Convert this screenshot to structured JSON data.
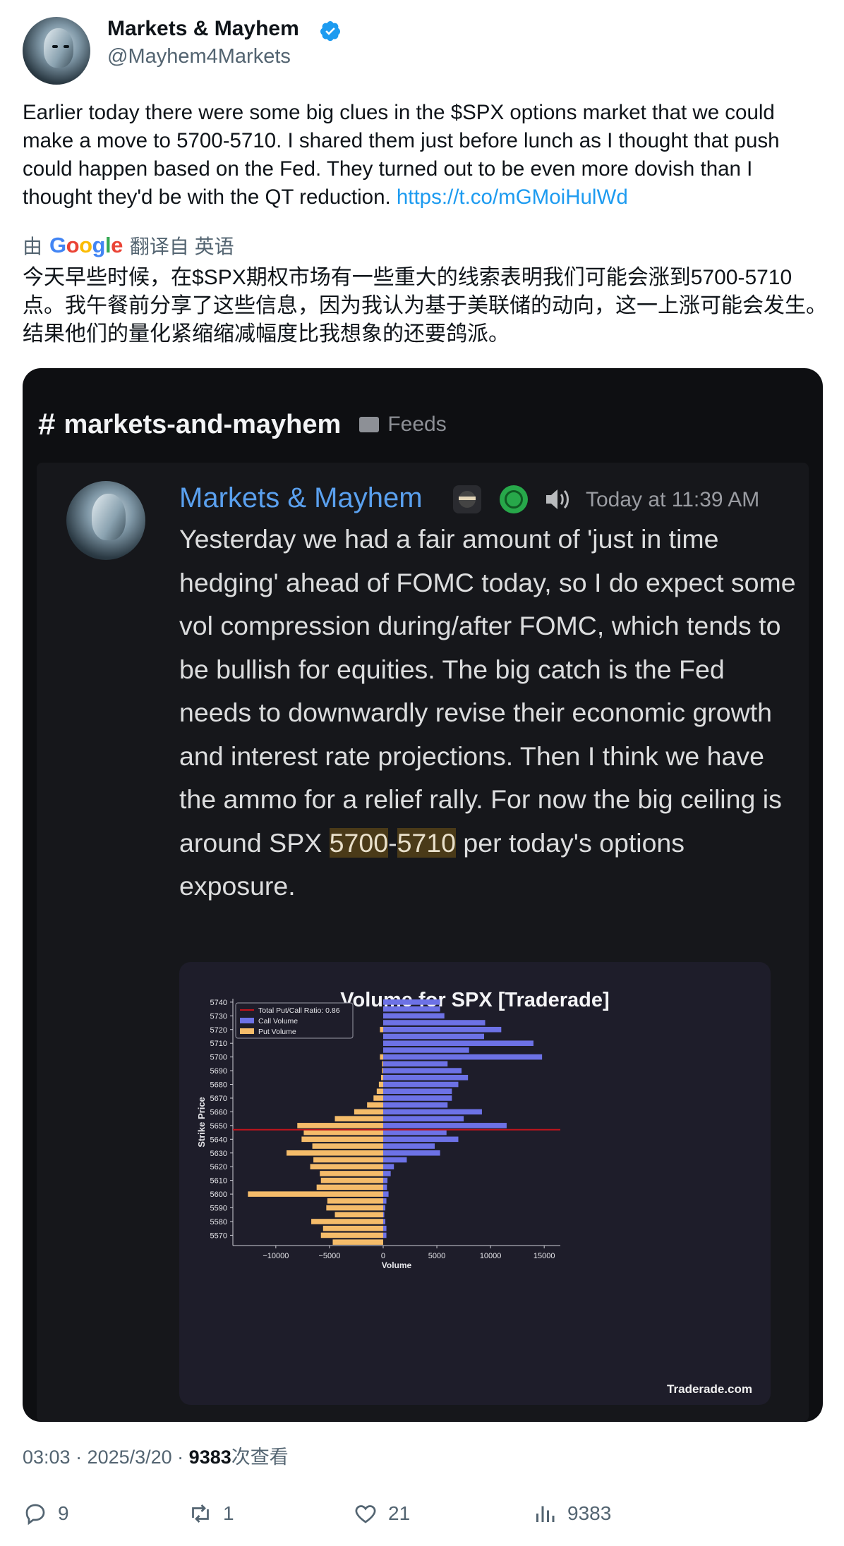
{
  "tweet": {
    "author_name": "Markets & Mayhem",
    "handle": "@Mayhem4Markets",
    "text": "Earlier today there were some big clues in the $SPX options market that we could make a move to 5700-5710. I shared them just before lunch as I thought that push could happen based on the Fed. They turned out to be even more dovish than I thought they'd be with the QT reduction.",
    "link": "https://t.co/mGMoiHulWd",
    "translate_by": "由",
    "translate_brand": "Google",
    "translate_from": "翻译自 英语",
    "translated_text": "今天早些时候，在$SPX期权市场有一些重大的线索表明我们可能会涨到5700-5710点。我午餐前分享了这些信息，因为我认为基于美联储的动向，这一上涨可能会发生。结果他们的量化紧缩缩减幅度比我想象的还要鸽派。",
    "time": "03:03 · 2025/3/20 · ",
    "views": "9383",
    "views_suffix": "次查看"
  },
  "media": {
    "channel": "markets-and-mayhem",
    "folder": "Feeds",
    "message": {
      "author": "Markets & Mayhem",
      "timestamp": "Today at 11:39 AM",
      "text_before": "Yesterday we had a fair amount of 'just in time hedging' ahead of FOMC today, so I do expect some vol compression during/after FOMC, which tends to be bullish for equities. The big catch is the Fed needs to downwardly revise their economic growth and interest rate projections. Then I think we have the ammo for a relief rally. For now the big ceiling is around SPX ",
      "hl1": "5700",
      "dash": "-",
      "hl2": "5710",
      "text_after": " per today's options exposure."
    },
    "watermark": "Traderade.com"
  },
  "chart_data": {
    "type": "bar",
    "orientation": "horizontal",
    "title": "Volume for SPX [Traderade]",
    "xlabel": "Volume",
    "ylabel": "Strike Price",
    "xlim": [
      -14000,
      16500
    ],
    "xticks": [
      -10000,
      -5000,
      0,
      5000,
      10000,
      15000
    ],
    "ytick_labels": [
      "5570",
      "5580",
      "5590",
      "5600",
      "5610",
      "5620",
      "5630",
      "5640",
      "5650",
      "5660",
      "5670",
      "5680",
      "5690",
      "5700",
      "5710",
      "5720",
      "5730",
      "5740"
    ],
    "strikes": [
      5565,
      5570,
      5575,
      5580,
      5585,
      5590,
      5595,
      5600,
      5605,
      5610,
      5615,
      5620,
      5625,
      5630,
      5635,
      5640,
      5645,
      5650,
      5655,
      5660,
      5665,
      5670,
      5675,
      5680,
      5685,
      5690,
      5695,
      5700,
      5705,
      5710,
      5715,
      5720,
      5725,
      5730,
      5735,
      5740
    ],
    "legend": [
      "Total Put/Call Ratio: 0.86",
      "Call Volume",
      "Put Volume"
    ],
    "legend_position": "top-left",
    "ratio_line_strike": 5647,
    "colors": {
      "call": "#6d72e6",
      "put": "#f5bc6a",
      "ratio": "#c0141c"
    },
    "series": [
      {
        "name": "Call Volume",
        "values": [
          0,
          300,
          300,
          200,
          100,
          200,
          300,
          500,
          350,
          400,
          700,
          1000,
          2200,
          5300,
          4800,
          7000,
          5900,
          11500,
          7500,
          9200,
          6000,
          6400,
          6400,
          7000,
          7900,
          7300,
          6000,
          14800,
          8000,
          14000,
          9400,
          11000,
          9500,
          5700,
          5300,
          5300
        ]
      },
      {
        "name": "Put Volume",
        "values": [
          -4700,
          -5800,
          -5600,
          -6700,
          -4500,
          -5300,
          -5200,
          -12600,
          -6200,
          -5800,
          -5900,
          -6800,
          -6500,
          -9000,
          -6600,
          -7600,
          -7400,
          -8000,
          -4500,
          -2700,
          -1500,
          -900,
          -600,
          -400,
          -200,
          -100,
          -100,
          -300,
          0,
          0,
          0,
          -300,
          0,
          0,
          0,
          0
        ]
      }
    ]
  }
}
